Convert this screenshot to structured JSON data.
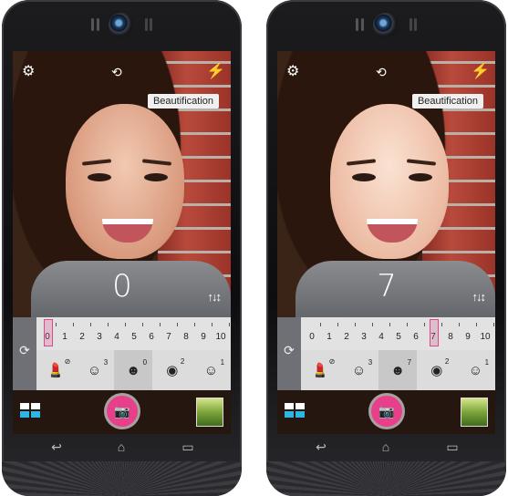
{
  "phones": [
    {
      "id": "before",
      "beautification_label": "Beautification",
      "level": "0",
      "scale_numbers": [
        "0",
        "1",
        "2",
        "3",
        "4",
        "5",
        "6",
        "7",
        "8",
        "9",
        "10"
      ],
      "selected_level_index": 0,
      "modes": [
        {
          "icon": "lipstick-icon",
          "sup": "⊘",
          "glyph": "💄"
        },
        {
          "icon": "face-slim-icon",
          "sup": "3",
          "glyph": "☺"
        },
        {
          "icon": "skin-smooth-icon",
          "sup": "0",
          "glyph": "☻"
        },
        {
          "icon": "eye-enlarge-icon",
          "sup": "2",
          "glyph": "◉"
        },
        {
          "icon": "complexion-icon",
          "sup": "1",
          "glyph": "☺"
        }
      ]
    },
    {
      "id": "after",
      "beautification_label": "Beautification",
      "level": "7",
      "scale_numbers": [
        "0",
        "1",
        "2",
        "3",
        "4",
        "5",
        "6",
        "7",
        "8",
        "9",
        "10"
      ],
      "selected_level_index": 7,
      "modes": [
        {
          "icon": "lipstick-icon",
          "sup": "⊘",
          "glyph": "💄"
        },
        {
          "icon": "face-slim-icon",
          "sup": "3",
          "glyph": "☺"
        },
        {
          "icon": "skin-smooth-icon",
          "sup": "7",
          "glyph": "☻"
        },
        {
          "icon": "eye-enlarge-icon",
          "sup": "2",
          "glyph": "◉"
        },
        {
          "icon": "complexion-icon",
          "sup": "1",
          "glyph": "☺"
        }
      ]
    }
  ],
  "icons": {
    "settings": "gear-icon",
    "switch_camera": "switch-camera-icon",
    "flash": "flash-icon",
    "shutter": "camera-icon",
    "gallery_grid": "grid-icon",
    "rotate": "rotate-icon",
    "back": "back-icon",
    "home": "home-icon",
    "recent": "recent-apps-icon"
  },
  "colors": {
    "accent": "#e83f8a",
    "gallery_blue": "#2bb6e6"
  }
}
